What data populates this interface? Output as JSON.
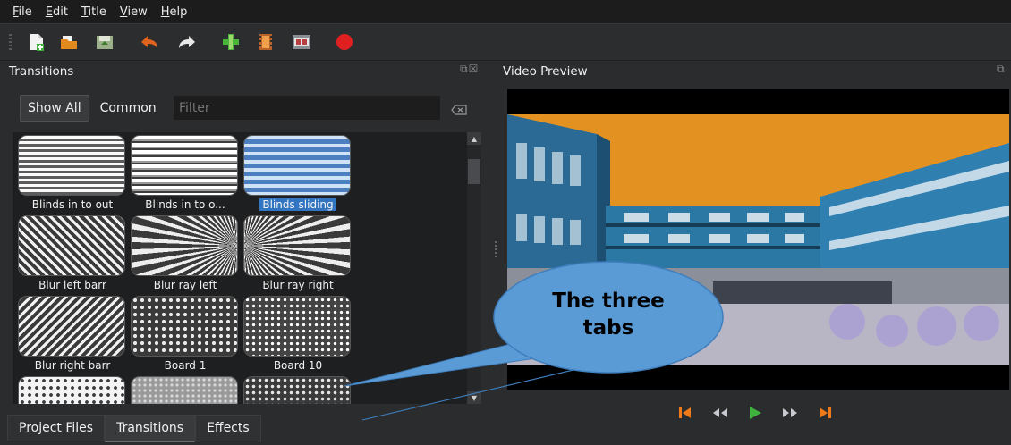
{
  "menu": [
    "File",
    "Edit",
    "Title",
    "View",
    "Help"
  ],
  "toolbar": {
    "buttons": [
      "new-project-icon",
      "open-project-icon",
      "save-project-icon",
      "undo-icon",
      "redo-icon",
      "import-files-icon",
      "profile-icon",
      "fullscreen-icon",
      "export-video-icon"
    ]
  },
  "transitions_panel": {
    "title": "Transitions",
    "show_all_label": "Show All",
    "common_label": "Common",
    "filter_placeholder": "Filter",
    "items": [
      {
        "label": "Blinds in to out",
        "selected": false
      },
      {
        "label": "Blinds in to o...",
        "selected": false
      },
      {
        "label": "Blinds sliding",
        "selected": true
      },
      {
        "label": "Blur left barr",
        "selected": false
      },
      {
        "label": "Blur ray left",
        "selected": false
      },
      {
        "label": "Blur ray right",
        "selected": false
      },
      {
        "label": "Blur right barr",
        "selected": false
      },
      {
        "label": "Board 1",
        "selected": false
      },
      {
        "label": "Board 10",
        "selected": false
      }
    ]
  },
  "tabs": [
    {
      "label": "Project Files",
      "active": false
    },
    {
      "label": "Transitions",
      "active": true
    },
    {
      "label": "Effects",
      "active": false
    }
  ],
  "video_preview": {
    "title": "Video Preview"
  },
  "callout": {
    "line1": "The three",
    "line2": "tabs"
  },
  "colors": {
    "accent": "#3276c3",
    "callout_fill": "#5b9bd5",
    "record": "#e02020"
  }
}
